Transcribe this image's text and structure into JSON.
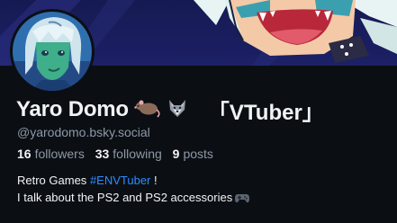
{
  "profile": {
    "display_name": "Yaro Domo",
    "name_emojis": [
      "rat-emoji",
      "wolf-emoji"
    ],
    "name_tag": "「VTuber」",
    "handle": "@yarodomo.bsky.social"
  },
  "stats": {
    "followers_count": "16",
    "followers_label": "followers",
    "following_count": "33",
    "following_label": "following",
    "posts_count": "9",
    "posts_label": "posts"
  },
  "bio": {
    "line1_text": "Retro Games",
    "line1_hashtag": "#ENVTuber",
    "line1_suffix": " !",
    "line2_text": "I talk about the PS2 and PS2 accessories",
    "line2_emoji": "gamepad-icon"
  },
  "colors": {
    "background": "#0b0f14",
    "text_primary": "#f1f3f5",
    "text_secondary": "#8e98a6",
    "link": "#2e8cff",
    "banner": "#1c2066"
  }
}
